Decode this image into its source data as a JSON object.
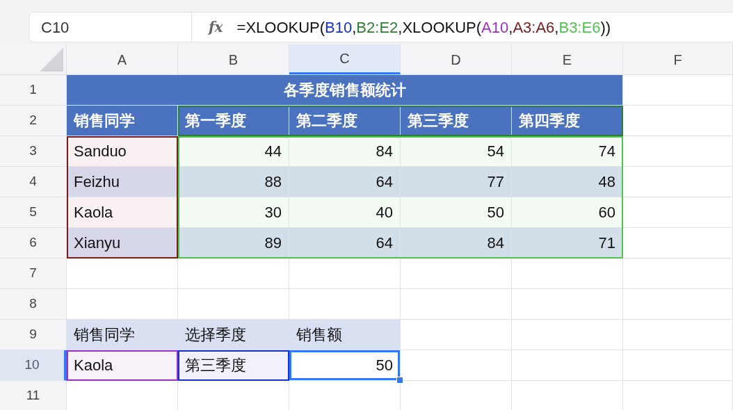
{
  "formula_bar": {
    "cell_name": "C10",
    "function_icon": "fx",
    "formula": [
      {
        "text": "=XLOOKUP(",
        "color": "#111111"
      },
      {
        "text": "B10",
        "color": "#1a2fd0"
      },
      {
        "text": ",",
        "color": "#111111"
      },
      {
        "text": "B2:E2",
        "color": "#2e7d32"
      },
      {
        "text": ",XLOOKUP(",
        "color": "#111111"
      },
      {
        "text": "A10",
        "color": "#9b30c8"
      },
      {
        "text": ",",
        "color": "#111111"
      },
      {
        "text": "A3:A6",
        "color": "#7a1c1c"
      },
      {
        "text": ",",
        "color": "#111111"
      },
      {
        "text": "B3:E6",
        "color": "#4fc34f"
      },
      {
        "text": "))",
        "color": "#111111"
      }
    ]
  },
  "columns": [
    {
      "label": "A",
      "selected": false
    },
    {
      "label": "B",
      "selected": false
    },
    {
      "label": "C",
      "selected": true
    },
    {
      "label": "D",
      "selected": false
    },
    {
      "label": "E",
      "selected": false
    },
    {
      "label": "F",
      "selected": false
    }
  ],
  "rows": [
    {
      "number": "1",
      "selected": false,
      "cells": [
        {
          "kind": "title",
          "text": "各季度销售额统计",
          "color": "#4a72bf",
          "selected": false
        }
      ]
    },
    {
      "number": "2",
      "selected": false,
      "cells": [
        {
          "kind": "header",
          "text": "销售同学",
          "color": "#4a72bf",
          "selected": false
        },
        {
          "kind": "header",
          "text": "第一季度",
          "color": "#4a72bf",
          "highlight": {
            "color": "#2e7d32"
          },
          "selected": false
        },
        {
          "kind": "header",
          "text": "第二季度",
          "color": "#4a72bf",
          "highlight": {
            "color": "#2e7d32"
          },
          "selected": false
        },
        {
          "kind": "header",
          "text": "第三季度",
          "color": "#4a72bf",
          "highlight": {
            "color": "#2e7d32"
          },
          "selected": false
        },
        {
          "kind": "header",
          "text": "第四季度",
          "color": "#4a72bf",
          "highlight": {
            "color": "#2e7d32"
          },
          "selected": false
        }
      ]
    },
    {
      "number": "3",
      "selected": false,
      "cells": [
        {
          "kind": "text",
          "text": "Sanduo",
          "color": "#f9f1f1",
          "highlight": {
            "color": "#7a1c1c"
          },
          "selected": false
        },
        {
          "kind": "number",
          "text": "44",
          "color": "#f3fbf2",
          "highlight": {
            "color": "#4fc34f"
          },
          "selected": false
        },
        {
          "kind": "number",
          "text": "84",
          "color": "#f3fbf2",
          "highlight": {
            "color": "#4fc34f"
          },
          "selected": false
        },
        {
          "kind": "number",
          "text": "54",
          "color": "#f3fbf2",
          "highlight": {
            "color": "#4fc34f"
          },
          "selected": false
        },
        {
          "kind": "number",
          "text": "74",
          "color": "#f3fbf2",
          "highlight": {
            "color": "#4fc34f"
          },
          "selected": false
        }
      ]
    },
    {
      "number": "4",
      "selected": false,
      "cells": [
        {
          "kind": "text",
          "text": "Feizhu",
          "color": "#d6d8ea",
          "highlight": {
            "color": "#7a1c1c"
          },
          "selected": false
        },
        {
          "kind": "number",
          "text": "88",
          "color": "#d2dfe9",
          "highlight": {
            "color": "#4fc34f"
          },
          "selected": false
        },
        {
          "kind": "number",
          "text": "64",
          "color": "#d2dfe9",
          "highlight": {
            "color": "#4fc34f"
          },
          "selected": false
        },
        {
          "kind": "number",
          "text": "77",
          "color": "#d2dfe9",
          "highlight": {
            "color": "#4fc34f"
          },
          "selected": false
        },
        {
          "kind": "number",
          "text": "48",
          "color": "#d2dfe9",
          "highlight": {
            "color": "#4fc34f"
          },
          "selected": false
        }
      ]
    },
    {
      "number": "5",
      "selected": false,
      "cells": [
        {
          "kind": "text",
          "text": "Kaola",
          "color": "#f9f1f1",
          "highlight": {
            "color": "#7a1c1c"
          },
          "selected": false
        },
        {
          "kind": "number",
          "text": "30",
          "color": "#f3fbf2",
          "highlight": {
            "color": "#4fc34f"
          },
          "selected": false
        },
        {
          "kind": "number",
          "text": "40",
          "color": "#f3fbf2",
          "highlight": {
            "color": "#4fc34f"
          },
          "selected": false
        },
        {
          "kind": "number",
          "text": "50",
          "color": "#f3fbf2",
          "highlight": {
            "color": "#4fc34f"
          },
          "selected": false
        },
        {
          "kind": "number",
          "text": "60",
          "color": "#f3fbf2",
          "highlight": {
            "color": "#4fc34f"
          },
          "selected": false
        }
      ]
    },
    {
      "number": "6",
      "selected": false,
      "cells": [
        {
          "kind": "text",
          "text": "Xianyu",
          "color": "#d6d8ea",
          "highlight": {
            "color": "#7a1c1c"
          },
          "selected": false
        },
        {
          "kind": "number",
          "text": "89",
          "color": "#d2dfe9",
          "highlight": {
            "color": "#4fc34f"
          },
          "selected": false
        },
        {
          "kind": "number",
          "text": "64",
          "color": "#d2dfe9",
          "highlight": {
            "color": "#4fc34f"
          },
          "selected": false
        },
        {
          "kind": "number",
          "text": "84",
          "color": "#d2dfe9",
          "highlight": {
            "color": "#4fc34f"
          },
          "selected": false
        },
        {
          "kind": "number",
          "text": "71",
          "color": "#d2dfe9",
          "highlight": {
            "color": "#4fc34f"
          },
          "selected": false
        }
      ]
    },
    {
      "number": "7",
      "selected": false,
      "cells": []
    },
    {
      "number": "8",
      "selected": false,
      "cells": []
    },
    {
      "number": "9",
      "selected": false,
      "cells": [
        {
          "kind": "text",
          "text": "销售同学",
          "color": "#d9e0f1",
          "selected": false
        },
        {
          "kind": "text",
          "text": "选择季度",
          "color": "#d9e0f1",
          "selected": false
        },
        {
          "kind": "text",
          "text": "销售额",
          "color": "#d9e0f1",
          "selected": false
        }
      ]
    },
    {
      "number": "10",
      "selected": true,
      "cells": [
        {
          "kind": "text",
          "text": "Kaola",
          "color": "#f7f1f9",
          "highlight": {
            "color": "#9b30c8"
          },
          "selected": false
        },
        {
          "kind": "text",
          "text": "第三季度",
          "color": "#f0f1fb",
          "highlight": {
            "color": "#1a2fd0"
          },
          "selected": false
        },
        {
          "kind": "number",
          "text": "50",
          "color": "#ffffff",
          "selected": true
        }
      ]
    },
    {
      "number": "11",
      "selected": false,
      "cells": []
    }
  ]
}
